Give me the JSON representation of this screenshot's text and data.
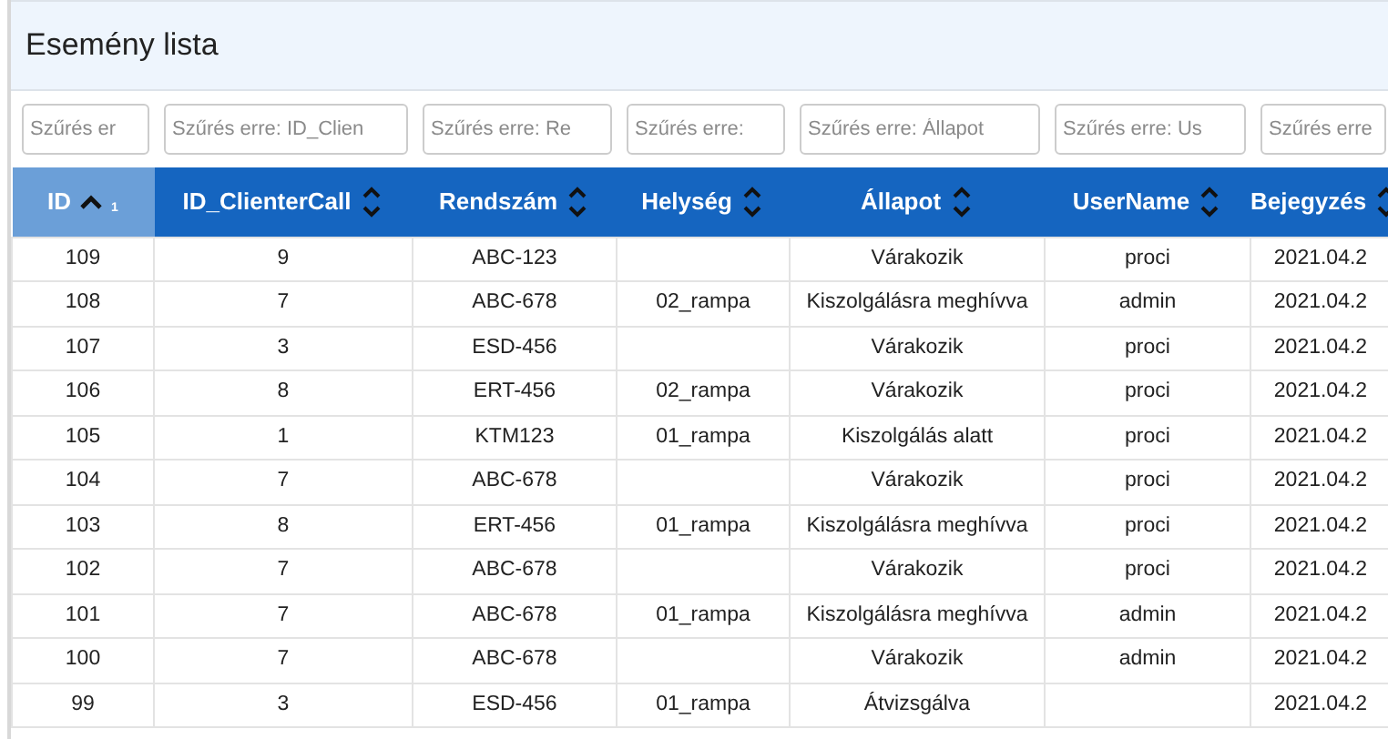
{
  "panel": {
    "title": "Esemény lista"
  },
  "table": {
    "columns": [
      {
        "label": "ID",
        "sorted": true,
        "sort_order": "1",
        "filter_placeholder": "Szűrés er"
      },
      {
        "label": "ID_ClienterCall",
        "sorted": false,
        "filter_placeholder": "Szűrés erre: ID_Clien"
      },
      {
        "label": "Rendszám",
        "sorted": false,
        "filter_placeholder": "Szűrés erre: Re"
      },
      {
        "label": "Helység",
        "sorted": false,
        "filter_placeholder": "Szűrés erre:"
      },
      {
        "label": "Állapot",
        "sorted": false,
        "filter_placeholder": "Szűrés erre: Állapot"
      },
      {
        "label": "UserName",
        "sorted": false,
        "filter_placeholder": "Szűrés erre: Us"
      },
      {
        "label": "Bejegyzés",
        "sorted": false,
        "filter_placeholder": "Szűrés erre"
      }
    ],
    "rows": [
      [
        "109",
        "9",
        "ABC-123",
        "",
        "Várakozik",
        "proci",
        "2021.04.2"
      ],
      [
        "108",
        "7",
        "ABC-678",
        "02_rampa",
        "Kiszolgálásra meghívva",
        "admin",
        "2021.04.2"
      ],
      [
        "107",
        "3",
        "ESD-456",
        "",
        "Várakozik",
        "proci",
        "2021.04.2"
      ],
      [
        "106",
        "8",
        "ERT-456",
        "02_rampa",
        "Várakozik",
        "proci",
        "2021.04.2"
      ],
      [
        "105",
        "1",
        "KTM123",
        "01_rampa",
        "Kiszolgálás alatt",
        "proci",
        "2021.04.2"
      ],
      [
        "104",
        "7",
        "ABC-678",
        "",
        "Várakozik",
        "proci",
        "2021.04.2"
      ],
      [
        "103",
        "8",
        "ERT-456",
        "01_rampa",
        "Kiszolgálásra meghívva",
        "proci",
        "2021.04.2"
      ],
      [
        "102",
        "7",
        "ABC-678",
        "",
        "Várakozik",
        "proci",
        "2021.04.2"
      ],
      [
        "101",
        "7",
        "ABC-678",
        "01_rampa",
        "Kiszolgálásra meghívva",
        "admin",
        "2021.04.2"
      ],
      [
        "100",
        "7",
        "ABC-678",
        "",
        "Várakozik",
        "admin",
        "2021.04.2"
      ],
      [
        "99",
        "3",
        "ESD-456",
        "01_rampa",
        "Átvizsgálva",
        "",
        "2021.04.2"
      ]
    ]
  }
}
